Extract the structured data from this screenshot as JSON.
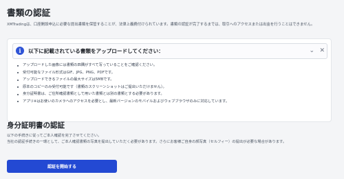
{
  "documents_section": {
    "title": "書類の認証",
    "intro": "XMTradingは、口座開設申込に必要な提出書類を保管することが、法律上義務付けられています。書類の認証が完了するまでは、取引へのアクセスまたは出金を行うことはできません。"
  },
  "upload_notice": {
    "title": "以下に記載されている書類をアップロードしてください：",
    "info_icon": "i",
    "collapse_icon": "⌄",
    "close_icon": "✕",
    "requirements": [
      "アップロードした画像には書類の四隅がすべて写っていることをご確認ください。",
      "受付可能なファイル形式はGIF、JPG、PNG、PDFです。",
      "アップロードできるファイルの最大サイズは5MBです。",
      "原本のコピーのみ受付可能です（書類のスクリーンショットはご提出いただけません）。",
      "身分証明書は、ご住所確認書類として用いた書類とは別の書類とする必要があります。",
      "アプリ※はお使いのカメラへのアクセスを必要とし、最新バージョンのモバイルおよびウェブブラウザのみに対応しています。"
    ]
  },
  "identity_section": {
    "title": "身分証明書の認証",
    "desc_line1": "以下の手続きに従ってご本人確認を完了させてください。",
    "desc_line2": "当社の認証手続きの一環として、ご本人確認書類の写真を提出していただく必要があります。さらにお客様ご自身の顔写真（セルフィー）の提出が必要な場合があります。",
    "start_button": "認証を開始する"
  }
}
